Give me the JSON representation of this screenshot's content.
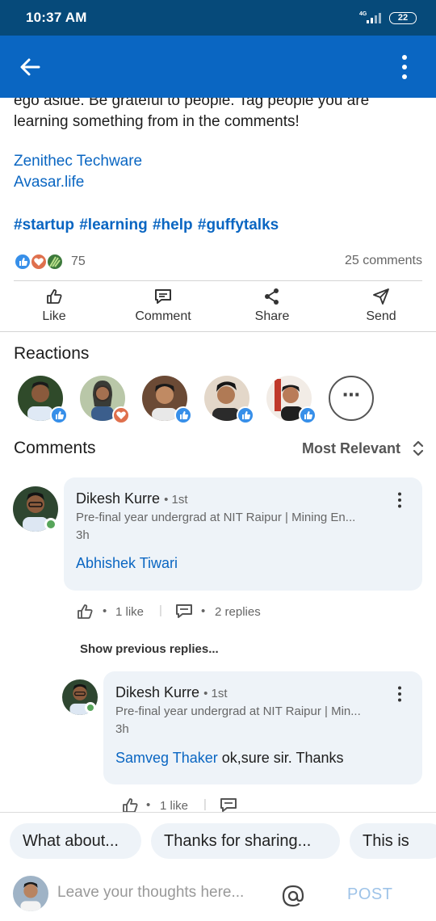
{
  "status_bar": {
    "time": "10:37 AM",
    "network": "4G",
    "battery": "22"
  },
  "post": {
    "text": "ego aside. Be grateful to people. Tag people you are learning something from in the comments!",
    "links": [
      "Zenithec Techware",
      "Avasar.life"
    ],
    "hashtags": "#startup #learning #help #guffytalks",
    "reaction_count": "75",
    "comments_count": "25 comments"
  },
  "actions": [
    {
      "label": "Like",
      "icon": "like-icon"
    },
    {
      "label": "Comment",
      "icon": "comment-icon"
    },
    {
      "label": "Share",
      "icon": "share-icon"
    },
    {
      "label": "Send",
      "icon": "send-icon"
    }
  ],
  "reactions": {
    "title": "Reactions",
    "more": "⋯",
    "reactors": [
      {
        "reaction": "like"
      },
      {
        "reaction": "love"
      },
      {
        "reaction": "like"
      },
      {
        "reaction": "like"
      },
      {
        "reaction": "like"
      }
    ]
  },
  "comments": {
    "title": "Comments",
    "sort": "Most Relevant",
    "items": [
      {
        "name": "Dikesh Kurre",
        "degree": "• 1st",
        "headline": "Pre-final year undergrad at NIT Raipur | Mining En...",
        "time": "3h",
        "mention": "Abhishek Tiwari",
        "text": "",
        "likes": "1 like",
        "replies": "2 replies"
      }
    ],
    "show_previous": "Show previous replies...",
    "reply": {
      "name": "Dikesh Kurre",
      "degree": "• 1st",
      "headline": "Pre-final year undergrad at NIT Raipur | Min...",
      "time": "3h",
      "mention": "Samveg Thaker",
      "text": "ok,sure sir. Thanks",
      "likes": "1 like"
    }
  },
  "suggestions": [
    "What about...",
    "Thanks for sharing...",
    "This is"
  ],
  "composer": {
    "placeholder": "Leave your thoughts here...",
    "post_label": "POST"
  },
  "colors": {
    "brand": "#0a66c2",
    "status_bar": "#064a7a",
    "bubble": "#eef3f8",
    "online": "#57a55a"
  }
}
